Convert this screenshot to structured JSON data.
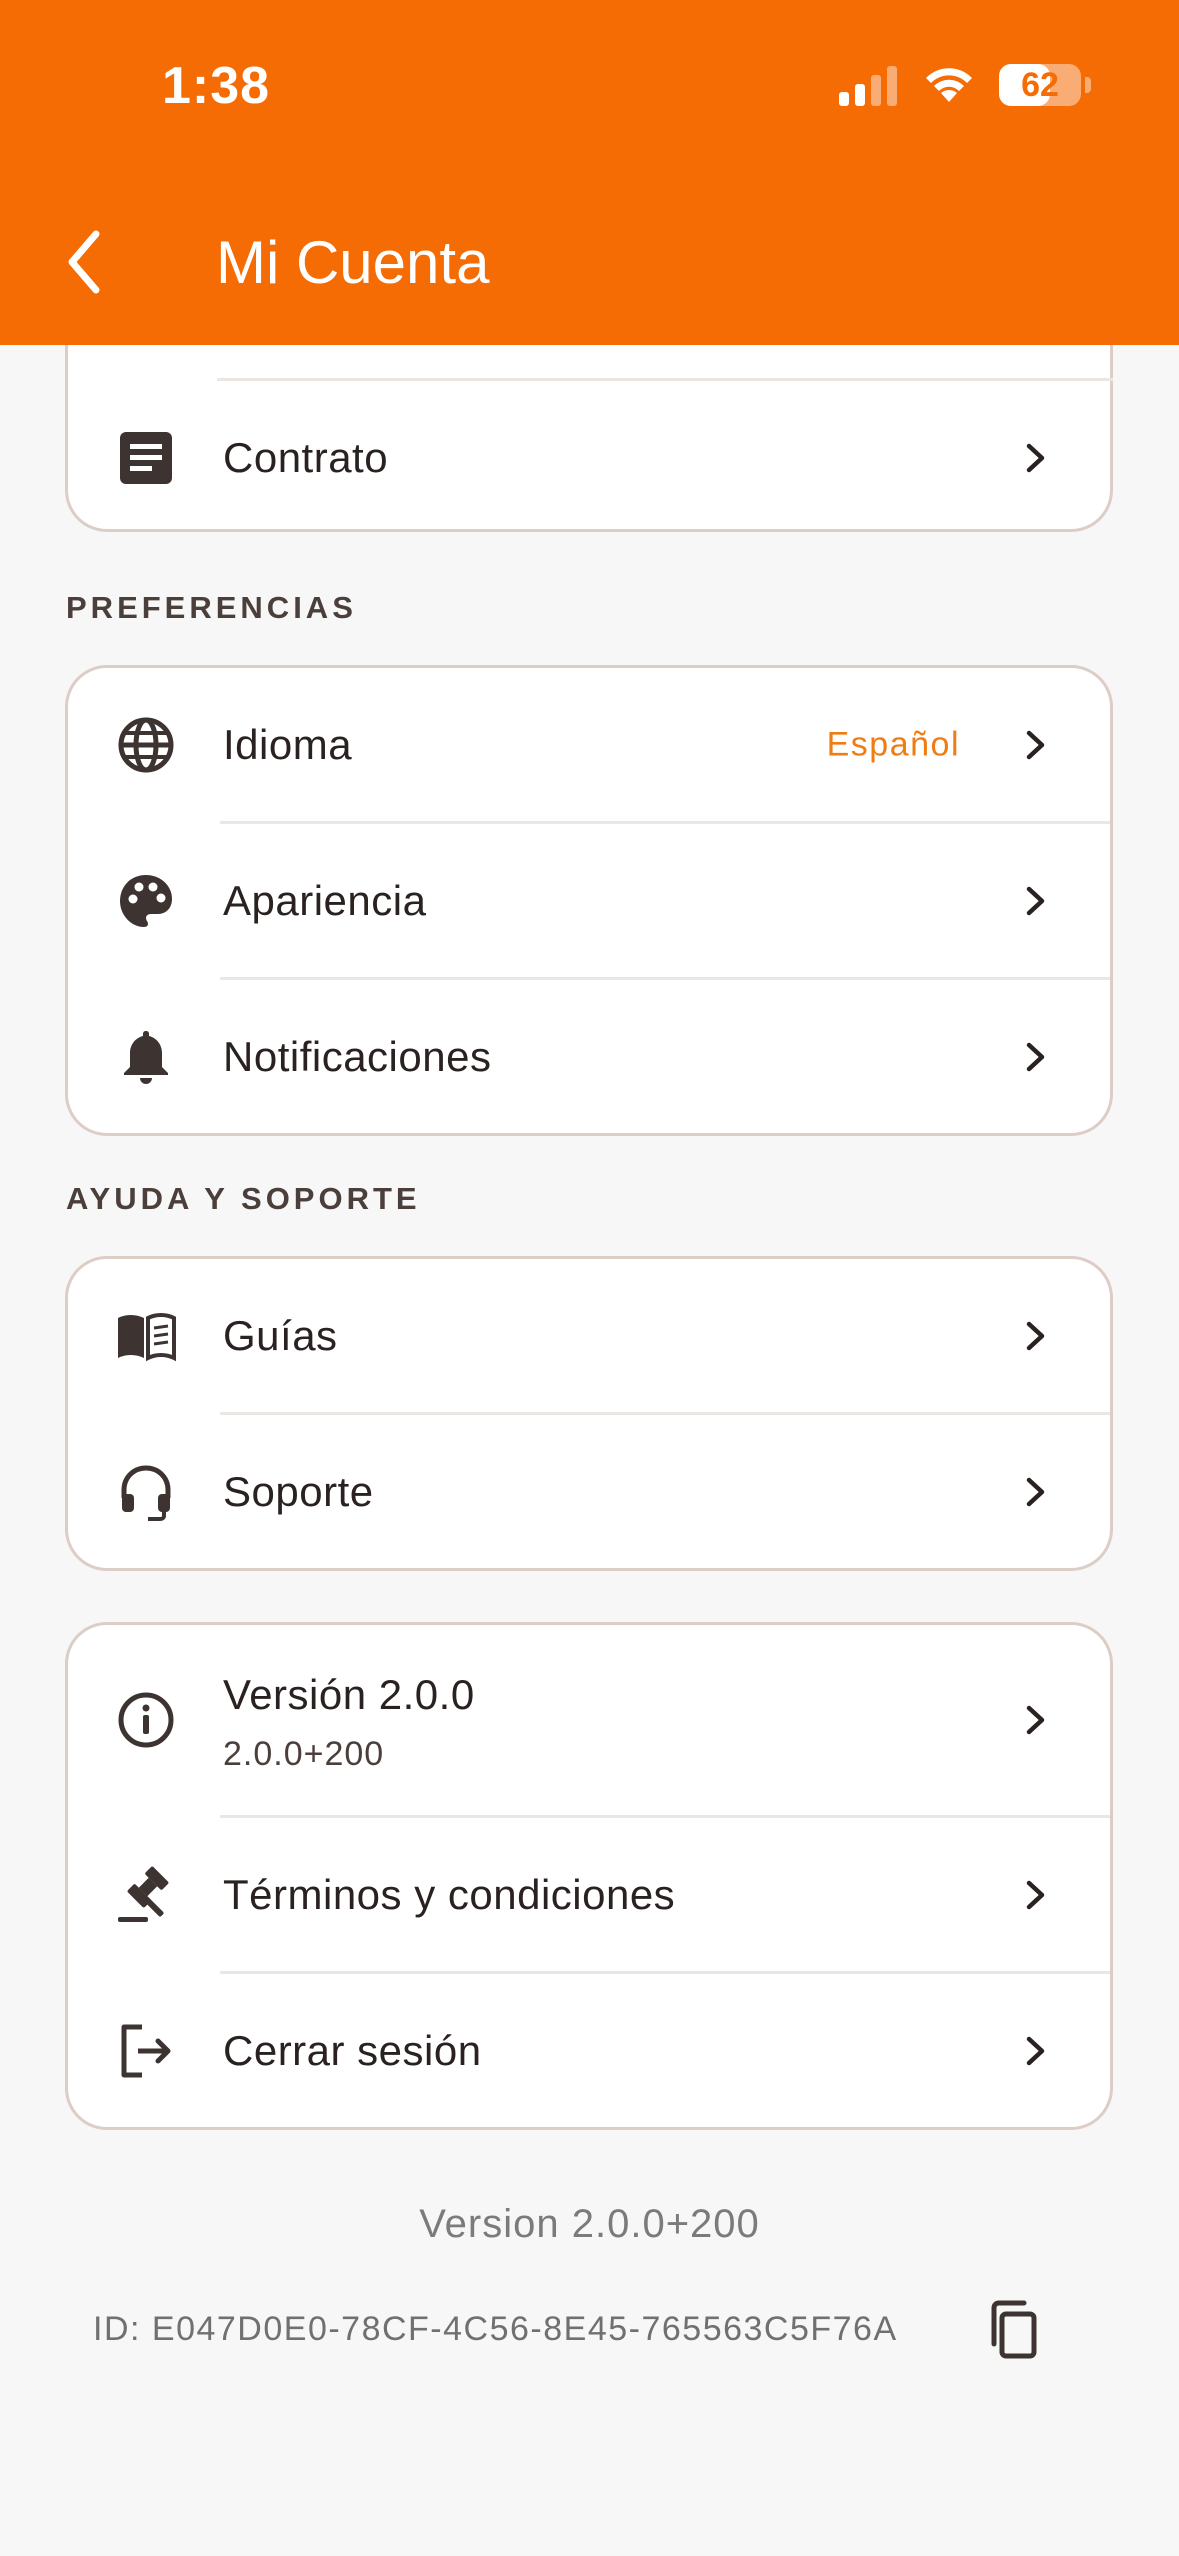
{
  "status_bar": {
    "time": "1:38",
    "battery": "62"
  },
  "header": {
    "title": "Mi Cuenta"
  },
  "account_card": {
    "items": [
      {
        "label": "Contrato",
        "icon": "document-icon"
      }
    ]
  },
  "preferences": {
    "title": "PREFERENCIAS",
    "items": [
      {
        "label": "Idioma",
        "value": "Español",
        "icon": "globe-icon"
      },
      {
        "label": "Apariencia",
        "icon": "palette-icon"
      },
      {
        "label": "Notificaciones",
        "icon": "bell-icon"
      }
    ]
  },
  "help": {
    "title": "AYUDA Y SOPORTE",
    "items": [
      {
        "label": "Guías",
        "icon": "book-icon"
      },
      {
        "label": "Soporte",
        "icon": "headset-icon"
      }
    ]
  },
  "about": {
    "items": [
      {
        "label": "Versión 2.0.0",
        "sublabel": "2.0.0+200",
        "icon": "info-icon"
      },
      {
        "label": "Términos y condiciones",
        "icon": "gavel-icon"
      },
      {
        "label": "Cerrar sesión",
        "icon": "logout-icon"
      }
    ]
  },
  "footer": {
    "version": "Version 2.0.0+200",
    "device_id": "ID: E047D0E0-78CF-4C56-8E45-765563C5F76A"
  },
  "colors": {
    "accent": "#f56b04",
    "value_text": "#f07c14",
    "card_border": "#dccdc6"
  }
}
